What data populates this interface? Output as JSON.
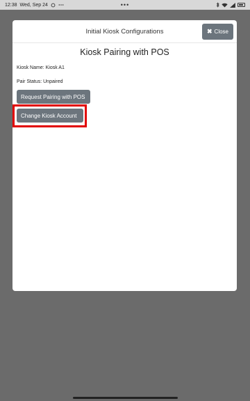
{
  "status_bar": {
    "time": "12:38",
    "date": "Wed, Sep 24",
    "center_dots": "•••"
  },
  "modal": {
    "title": "Initial Kiosk Configurations",
    "close_label": "Close",
    "section_heading": "Kiosk Pairing with POS",
    "kiosk_name": "Kiosk Name: Kiosk A1",
    "pair_status": "Pair Status: Unpaired",
    "request_pairing_label": "Request Pairing with POS",
    "change_account_label": "Change Kiosk Account"
  },
  "colors": {
    "button_gray": "#6c757d",
    "highlight_red": "#e10000",
    "backdrop": "#6b6b6b"
  },
  "icons": {
    "close": "close-icon",
    "bluetooth": "bluetooth-icon",
    "wifi": "wifi-icon",
    "signal": "signal-icon",
    "battery": "battery-icon"
  }
}
